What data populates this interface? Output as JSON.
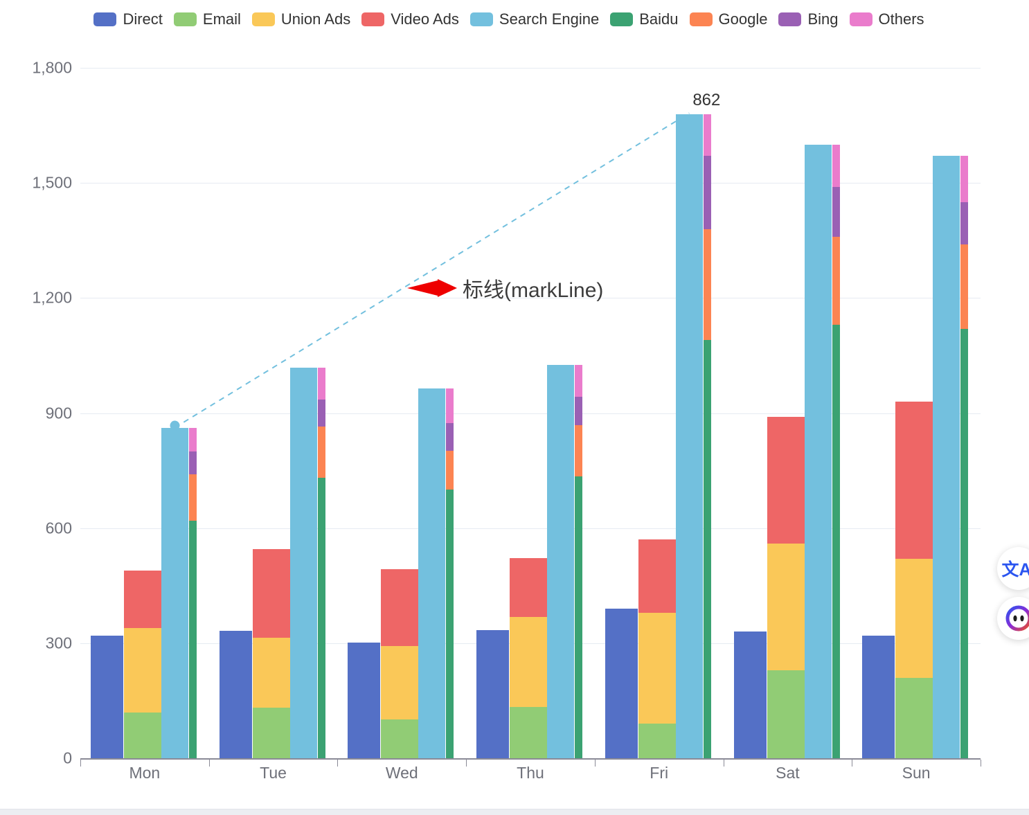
{
  "legend": {
    "items": [
      {
        "label": "Direct",
        "color": "#5470c6"
      },
      {
        "label": "Email",
        "color": "#91cc75"
      },
      {
        "label": "Union Ads",
        "color": "#fac858"
      },
      {
        "label": "Video Ads",
        "color": "#ee6666"
      },
      {
        "label": "Search Engine",
        "color": "#73c0de"
      },
      {
        "label": "Baidu",
        "color": "#3ba272"
      },
      {
        "label": "Google",
        "color": "#fc8452"
      },
      {
        "label": "Bing",
        "color": "#9a60b4"
      },
      {
        "label": "Others",
        "color": "#ea7ccc"
      }
    ]
  },
  "annotation": {
    "text": "标线(markLine)",
    "arrow_color": "#ee0000"
  },
  "markline": {
    "label": "862",
    "color": "#73c0de",
    "from_category": "Mon",
    "to_category": "Fri",
    "from_value": 862,
    "to_value": 1682
  },
  "floating_buttons": [
    {
      "name": "translate",
      "glyph": "文A"
    },
    {
      "name": "assistant",
      "glyph": ""
    }
  ],
  "chart_data": {
    "type": "bar",
    "title": "",
    "subtitle": "",
    "xlabel": "",
    "ylabel": "",
    "stacked": true,
    "grid": true,
    "legend_position": "top",
    "categories": [
      "Mon",
      "Tue",
      "Wed",
      "Thu",
      "Fri",
      "Sat",
      "Sun"
    ],
    "yticks": [
      0,
      300,
      600,
      900,
      1200,
      1500,
      1800
    ],
    "ylim": [
      0,
      1800
    ],
    "ytick_labels": [
      "0",
      "300",
      "600",
      "900",
      "1,200",
      "1,500",
      "1,800"
    ],
    "stacks": {
      "Ad": [
        "Direct"
      ],
      "Ad2": [
        "Email",
        "Union Ads",
        "Video Ads"
      ],
      "Engine": [
        "Search Engine"
      ],
      "Search": [
        "Baidu",
        "Google",
        "Bing",
        "Others"
      ]
    },
    "series": [
      {
        "name": "Direct",
        "stack": "Ad",
        "color": "#5470c6",
        "values": [
          320,
          332,
          301,
          334,
          390,
          330,
          320
        ]
      },
      {
        "name": "Email",
        "stack": "Ad2",
        "color": "#91cc75",
        "values": [
          120,
          132,
          101,
          134,
          90,
          230,
          210
        ]
      },
      {
        "name": "Union Ads",
        "stack": "Ad2",
        "color": "#fac858",
        "values": [
          220,
          182,
          191,
          234,
          290,
          330,
          310
        ]
      },
      {
        "name": "Video Ads",
        "stack": "Ad2",
        "color": "#ee6666",
        "values": [
          150,
          232,
          201,
          154,
          190,
          330,
          410
        ]
      },
      {
        "name": "Search Engine",
        "stack": "Engine",
        "color": "#73c0de",
        "values": [
          862,
          1018,
          964,
          1026,
          1679,
          1600,
          1570
        ]
      },
      {
        "name": "Baidu",
        "stack": "Search",
        "color": "#3ba272",
        "values": [
          620,
          732,
          701,
          734,
          1090,
          1130,
          1120
        ]
      },
      {
        "name": "Google",
        "stack": "Search",
        "color": "#fc8452",
        "values": [
          120,
          132,
          101,
          134,
          290,
          230,
          220
        ]
      },
      {
        "name": "Bing",
        "stack": "Search",
        "color": "#9a60b4",
        "values": [
          60,
          72,
          71,
          74,
          190,
          130,
          110
        ]
      },
      {
        "name": "Others",
        "stack": "Search",
        "color": "#ea7ccc",
        "values": [
          62,
          82,
          91,
          84,
          109,
          110,
          120
        ]
      }
    ]
  }
}
